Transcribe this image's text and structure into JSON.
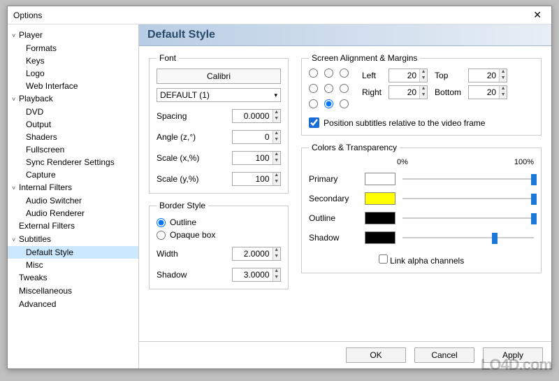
{
  "window": {
    "title": "Options"
  },
  "tree": [
    {
      "label": "Player",
      "root": true,
      "expanded": true
    },
    {
      "label": "Formats",
      "child": true
    },
    {
      "label": "Keys",
      "child": true
    },
    {
      "label": "Logo",
      "child": true
    },
    {
      "label": "Web Interface",
      "child": true
    },
    {
      "label": "Playback",
      "root": true,
      "expanded": true
    },
    {
      "label": "DVD",
      "child": true
    },
    {
      "label": "Output",
      "child": true
    },
    {
      "label": "Shaders",
      "child": true
    },
    {
      "label": "Fullscreen",
      "child": true
    },
    {
      "label": "Sync Renderer Settings",
      "child": true
    },
    {
      "label": "Capture",
      "child": true
    },
    {
      "label": "Internal Filters",
      "root": true,
      "expanded": true
    },
    {
      "label": "Audio Switcher",
      "child": true
    },
    {
      "label": "Audio Renderer",
      "child": true
    },
    {
      "label": "External Filters",
      "root": true
    },
    {
      "label": "Subtitles",
      "root": true,
      "expanded": true
    },
    {
      "label": "Default Style",
      "child": true,
      "selected": true
    },
    {
      "label": "Misc",
      "child": true
    },
    {
      "label": "Tweaks",
      "root": true
    },
    {
      "label": "Miscellaneous",
      "root": true
    },
    {
      "label": "Advanced",
      "root": true
    }
  ],
  "header": "Default Style",
  "font": {
    "legend": "Font",
    "name": "Calibri",
    "charset": "DEFAULT (1)",
    "spacing_label": "Spacing",
    "spacing": "0.0000",
    "angle_label": "Angle (z,°)",
    "angle": "0",
    "scalex_label": "Scale (x,%)",
    "scalex": "100",
    "scaley_label": "Scale (y,%)",
    "scaley": "100"
  },
  "border": {
    "legend": "Border Style",
    "outline": "Outline",
    "opaque": "Opaque box",
    "width_label": "Width",
    "width": "2.0000",
    "shadow_label": "Shadow",
    "shadow": "3.0000"
  },
  "align": {
    "legend": "Screen Alignment & Margins",
    "selected": 7,
    "left_label": "Left",
    "left": "20",
    "top_label": "Top",
    "top": "20",
    "right_label": "Right",
    "right": "20",
    "bottom_label": "Bottom",
    "bottom": "20",
    "relative": "Position subtitles relative to the video frame"
  },
  "colors": {
    "legend": "Colors & Transparency",
    "pct0": "0%",
    "pct100": "100%",
    "rows": [
      {
        "label": "Primary",
        "color": "#ffffff",
        "alpha": 100
      },
      {
        "label": "Secondary",
        "color": "#ffff00",
        "alpha": 100
      },
      {
        "label": "Outline",
        "color": "#000000",
        "alpha": 100
      },
      {
        "label": "Shadow",
        "color": "#000000",
        "alpha": 70
      }
    ],
    "link": "Link alpha channels"
  },
  "footer": {
    "ok": "OK",
    "cancel": "Cancel",
    "apply": "Apply"
  },
  "watermark": "LO4D.com"
}
